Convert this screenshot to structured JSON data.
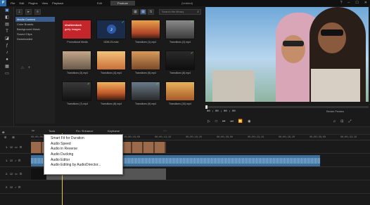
{
  "titlebar": {
    "logo": "P",
    "menu": [
      "File",
      "Edit",
      "Plugins",
      "View",
      "Playback"
    ],
    "tabs": [
      "Edit",
      "Produce",
      ""
    ],
    "title": "(Untitled)",
    "controls": [
      "?",
      "–",
      "☐",
      "✕"
    ]
  },
  "library": {
    "search_placeholder": "Search the library",
    "categories": [
      "Media Content",
      "Color Boards",
      "Background Music",
      "Sound Clips",
      "Downloaded"
    ],
    "items": [
      {
        "label": "Promotional Media",
        "type": "promo"
      },
      {
        "label": "DDM-20-m4a",
        "type": "music"
      },
      {
        "label": "Transitions (1).mp4",
        "type": "sunset"
      },
      {
        "label": "Transitions (2).mp4",
        "type": "guitar"
      },
      {
        "label": "Transitions (3).mp4",
        "type": "road"
      },
      {
        "label": "Transitions (4).mp4",
        "type": "ocean"
      },
      {
        "label": "Transitions (5).mp4",
        "type": "sunset"
      },
      {
        "label": "Transitions (6).mp4",
        "type": "dark"
      },
      {
        "label": "Transitions (7).mp4",
        "type": "dark"
      },
      {
        "label": "Transitions (8).mp4",
        "type": "sunset"
      },
      {
        "label": "Transitions (9).mp4",
        "type": "road"
      },
      {
        "label": "Transitions (10).mp4",
        "type": "sunset"
      }
    ],
    "promo_text": [
      "shutterstock",
      "getty images"
    ]
  },
  "preview": {
    "timecode": "00 ; 00 ; 00 ; 00",
    "render_label": "Render Preview"
  },
  "timeline": {
    "toolbar": [
      "Tools",
      "Fix / Enhance",
      "Keyframe"
    ],
    "ruler_labels": [
      "00;00;00;00",
      "00;00;03;10",
      "00;00;06;20",
      "00;00;10;00",
      "00;00;13;10",
      "00;00;16;20",
      "00;00;20;00",
      "00;00;23;10",
      "00;00;26;20",
      "00;00;30;00",
      "00;00;33;10"
    ],
    "tracks": [
      "1.",
      "1.",
      "2.",
      "2."
    ]
  },
  "context_menu": {
    "items": [
      "Smart Fit for Duration",
      "Audio Speed",
      "Audio in Reverse",
      "Audio Ducking",
      "Audio Editor",
      "Audio Editing by AudioDirector..."
    ]
  }
}
